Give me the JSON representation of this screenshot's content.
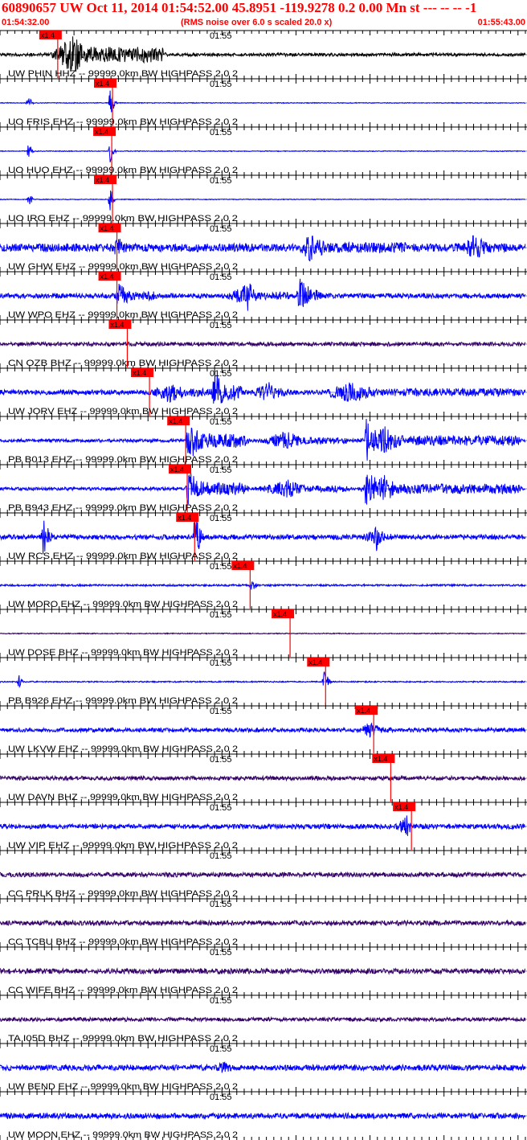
{
  "header": {
    "title": "60890657 UW Oct 11, 2014 01:54:52.00   45.8951 -119.9278  0.2 0.00 Mn st --- -- --  -1",
    "start_time": "01:54:32.00",
    "noise_note": "(RMS noise over 6.0 s scaled 20.0 x)",
    "end_time": "01:55:43.00"
  },
  "colors": {
    "header": "#ff0000",
    "axis": "#000000",
    "pick": "#ff0000",
    "blue": "#0000ff",
    "purple": "#330066"
  },
  "chart_data": {
    "type": "line",
    "title": "60890657 UW Oct 11, 2014 01:54:52.00   45.8951 -119.9278  0.2 0.00 Mn st --- -- --  -1",
    "x_range": [
      "01:54:32.00",
      "01:55:43.00"
    ],
    "time_marker_label": "01:55",
    "pick_label": "x1.4",
    "series": [
      {
        "label": "UW PHIN HHZ -- 99999.0km BW  HIGHPASS  2.0  2",
        "color": "black",
        "pick_s": 7.8,
        "events": [
          [
            6.5,
            23,
            4,
            28,
            1.0
          ]
        ],
        "bg": 2
      },
      {
        "label": "UO FRIS EHZ -- 99999.0km BW  HIGHPASS  2.0  2",
        "color": "blue",
        "pick_s": 15.2,
        "events": [
          [
            3.5,
            4.5,
            0.3,
            18,
            0.3
          ],
          [
            14.6,
            15.8,
            0.3,
            22,
            0.3
          ]
        ],
        "bg": 0.5
      },
      {
        "label": "UO HUO EHZ -- 99999.0km BW  HIGHPASS  2.0  2",
        "color": "blue",
        "pick_s": 15.1,
        "events": [
          [
            3.6,
            4.6,
            0.3,
            20,
            0.3
          ],
          [
            14.6,
            15.7,
            0.3,
            22,
            0.3
          ]
        ],
        "bg": 0.5
      },
      {
        "label": "UO IRO EHZ -- 99999.0km BW  HIGHPASS  2.0  2",
        "color": "blue",
        "pick_s": 15.2,
        "events": [
          [
            3.6,
            4.6,
            0.3,
            16,
            0.3
          ],
          [
            14.6,
            15.7,
            0.3,
            22,
            0.3
          ]
        ],
        "bg": 0.5
      },
      {
        "label": "UW GHW EHZ -- 99999.0km BW  HIGHPASS  2.0  2",
        "color": "blue",
        "pick_s": 15.8,
        "events": [
          [
            15.3,
            18,
            0.3,
            14,
            0.4
          ],
          [
            40,
            56,
            2,
            18,
            0.4
          ],
          [
            62,
            70,
            2,
            16,
            0.4
          ]
        ],
        "bg": 5
      },
      {
        "label": "UW WPO EHZ -- 99999.0km BW  HIGHPASS  2.0  2",
        "color": "blue",
        "pick_s": 15.8,
        "events": [
          [
            15.5,
            22,
            0.5,
            16,
            0.5
          ],
          [
            30,
            40,
            3,
            14,
            0.4
          ],
          [
            33,
            35,
            0.3,
            22,
            0.4
          ],
          [
            40,
            44,
            0.5,
            22,
            0.5
          ]
        ],
        "bg": 3
      },
      {
        "label": "CN OZB BHZ -- 99999.0km BW  HIGHPASS  2.0  2",
        "color": "purple",
        "pick_s": 17.2,
        "events": [],
        "bg": 2.5
      },
      {
        "label": "UW JORV EHZ -- 99999.0km BW  HIGHPASS  2.0  2",
        "color": "blue",
        "pick_s": 20.2,
        "events": [
          [
            20,
            30,
            3,
            14,
            0.5
          ],
          [
            28.5,
            33.5,
            0.5,
            30,
            0.6
          ],
          [
            33.5,
            40,
            3,
            14,
            0.5
          ],
          [
            42,
            71,
            6,
            14,
            0.4
          ]
        ],
        "bg": 3
      },
      {
        "label": "PB B013 EHZ -- 99999.0km BW  HIGHPASS  2.0  2",
        "color": "blue",
        "pick_s": 25.1,
        "events": [
          [
            25,
            34,
            0.5,
            26,
            0.5
          ],
          [
            34,
            48,
            5,
            12,
            0.5
          ],
          [
            48,
            71,
            4,
            18,
            0.5
          ],
          [
            49,
            53,
            0.5,
            28,
            0.5
          ]
        ],
        "bg": 2
      },
      {
        "label": "PB B943 EHZ -- 99999.0km BW  HIGHPASS  2.0  2",
        "color": "blue",
        "pick_s": 25.3,
        "events": [
          [
            25,
            34,
            0.5,
            24,
            0.5
          ],
          [
            34,
            48,
            5,
            12,
            0.5
          ],
          [
            48,
            71,
            4,
            18,
            0.5
          ],
          [
            49,
            53,
            0.5,
            26,
            0.5
          ]
        ],
        "bg": 2
      },
      {
        "label": "UW RCS EHZ -- 99999.0km BW  HIGHPASS  2.0  2",
        "color": "blue",
        "pick_s": 26.3,
        "events": [
          [
            5.5,
            7.5,
            0.3,
            22,
            0.5
          ],
          [
            26,
            28,
            0.3,
            26,
            0.5
          ],
          [
            48,
            54,
            3,
            10,
            0.5
          ],
          [
            50.5,
            51.8,
            0.3,
            26,
            0.5
          ]
        ],
        "bg": 3
      },
      {
        "label": "UW MORO EHZ -- 99999.0km BW  HIGHPASS  2.0  2",
        "color": "blue",
        "pick_s": 33.8,
        "events": [
          [
            33.5,
            35.5,
            0.5,
            6,
            0.5
          ]
        ],
        "bg": 1.2
      },
      {
        "label": "UW DOSE BHZ -- 99999.0km BW  HIGHPASS  2.0  2",
        "color": "purple",
        "pick_s": 39.2,
        "events": [],
        "bg": 0.6
      },
      {
        "label": "PB B926 EHZ -- 99999.0km BW  HIGHPASS  2.0  2",
        "color": "blue",
        "pick_s": 44.0,
        "events": [
          [
            2.3,
            3.3,
            0.2,
            14,
            0.3
          ],
          [
            43.5,
            45,
            0.3,
            14,
            0.4
          ]
        ],
        "bg": 0.8
      },
      {
        "label": "UW LKVW EHZ -- 99999.0km BW  HIGHPASS  2.0  2",
        "color": "blue",
        "pick_s": 50.5,
        "events": [
          [
            34.5,
            35.5,
            0.3,
            8,
            0.4
          ],
          [
            48,
            54,
            2,
            10,
            0.5
          ]
        ],
        "bg": 2.5
      },
      {
        "label": "UW DAVN BHZ -- 99999.0km BW  HIGHPASS  2.0  2",
        "color": "purple",
        "pick_s": 52.8,
        "events": [],
        "bg": 2.5
      },
      {
        "label": "UW VIP EHZ -- 99999.0km BW  HIGHPASS  2.0  2",
        "color": "blue",
        "pick_s": 55.6,
        "events": [
          [
            53,
            56.2,
            2,
            14,
            0.5
          ]
        ],
        "bg": 3
      },
      {
        "label": "CC PRLK BHZ -- 99999.0km BW  HIGHPASS  2.0  2",
        "color": "purple",
        "pick_s": null,
        "events": [],
        "bg": 2.8
      },
      {
        "label": "CC TCBU BHZ -- 99999.0km BW  HIGHPASS  2.0  2",
        "color": "purple",
        "pick_s": null,
        "events": [],
        "bg": 3
      },
      {
        "label": "CC WIFE BHZ -- 99999.0km BW  HIGHPASS  2.0  2",
        "color": "purple",
        "pick_s": null,
        "events": [],
        "bg": 3.2
      },
      {
        "label": "TA I05D BHZ -- 99999.0km BW  HIGHPASS  2.0  2",
        "color": "purple",
        "pick_s": null,
        "events": [],
        "bg": 2.4
      },
      {
        "label": "UW BEND EHZ -- 99999.0km BW  HIGHPASS  2.0  2",
        "color": "blue",
        "pick_s": null,
        "events": [
          [
            29,
            33,
            1,
            8,
            0.5
          ]
        ],
        "bg": 3.5
      },
      {
        "label": "UW MOON EHZ -- 99999.0km BW  HIGHPASS  2.0  2",
        "color": "blue",
        "pick_s": null,
        "events": [],
        "bg": 3.5
      }
    ]
  }
}
